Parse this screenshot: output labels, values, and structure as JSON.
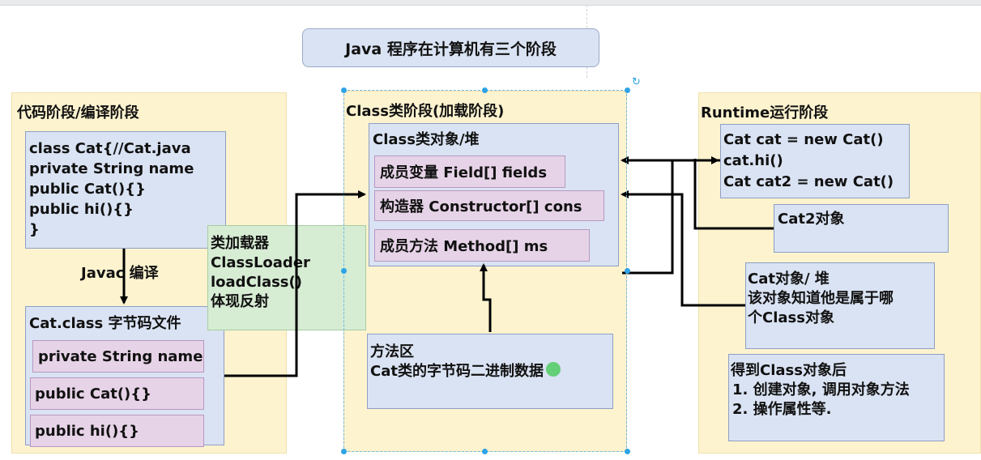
{
  "title": "Java 程序在计算机有三个阶段",
  "stages": {
    "code": {
      "title": "代码阶段/编译阶段",
      "source_lines": [
        "class Cat{//Cat.java",
        "private String name",
        "public Cat(){}",
        "public hi(){}",
        "}"
      ],
      "compile_label": "Javac 编译",
      "bytecode_title": "Cat.class 字节码文件",
      "bytecode_members": [
        "private String name",
        "public Cat(){}",
        "public hi(){}"
      ]
    },
    "classloader": {
      "lines": [
        "类加载器",
        "ClassLoader",
        "loadClass()",
        "体现反射"
      ]
    },
    "class": {
      "title": "Class类阶段(加载阶段)",
      "object_title": "Class类对象/堆",
      "members": [
        "成员变量 Field[] fields",
        "构造器 Constructor[] cons",
        "成员方法 Method[] ms"
      ],
      "method_area_lines": [
        "方法区",
        "Cat类的字节码二进制数据"
      ]
    },
    "runtime": {
      "title": "Runtime运行阶段",
      "code_lines": [
        "Cat cat = new Cat()",
        "cat.hi()",
        "Cat cat2 = new Cat()"
      ],
      "cat2_label": "Cat2对象",
      "cat_object_lines": [
        "Cat对象/ 堆",
        "该对象知道他是属于哪",
        "个Class对象"
      ],
      "notes_lines": [
        "得到Class对象后",
        "1. 创建对象, 调用对象方法",
        "2. 操作属性等."
      ]
    }
  },
  "colors": {
    "stage_bg": "#fdf3cf",
    "blue_box": "#dae3f3",
    "pink_box": "#e6d3e7",
    "green_box": "#d6ecd3",
    "selection": "#2ea3e6"
  }
}
